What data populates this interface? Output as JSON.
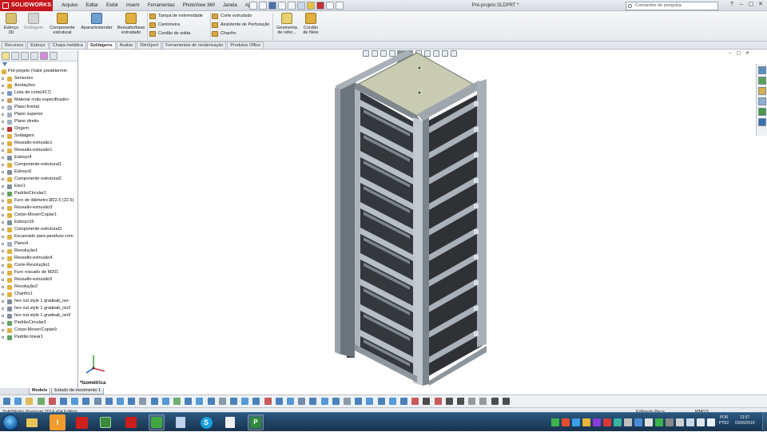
{
  "app": {
    "logo_text": "SOLIDWORKS",
    "menus": [
      "Arquivo",
      "Editar",
      "Exibir",
      "Inserir",
      "Ferramentas",
      "PhotoView 360",
      "Janela",
      "Ajuda"
    ],
    "document_title": "Pré-projeto.SLDPRT *",
    "search_placeholder": "Comandos de pesquisa",
    "window_controls": [
      "?",
      "–",
      "▢",
      "✕"
    ]
  },
  "command_manager": {
    "big_buttons": [
      {
        "label_line1": "Esboço",
        "label_line2": "3D",
        "icon": "3d-sketch-icon"
      },
      {
        "label_line1": "Soldagem",
        "label_line2": "",
        "icon": "weldment-icon"
      },
      {
        "label_line1": "Componente",
        "label_line2": "estrutural",
        "icon": "structural-member-icon"
      },
      {
        "label_line1": "Aparar/estender",
        "label_line2": "",
        "icon": "trim-extend-icon"
      },
      {
        "label_line1": "Ressalto/base",
        "label_line2": "extrudado",
        "icon": "extruded-boss-icon"
      }
    ],
    "small_buttons_col1": [
      "Tampa de extremidade",
      "Cantoneira",
      "Cordão de solda"
    ],
    "small_buttons_col2": [
      "Corte extrudado",
      "Assistente de Perfuração",
      "Chanfro"
    ],
    "big_buttons_right": [
      {
        "label_line1": "Geometria",
        "label_line2": "de refer...",
        "icon": "reference-geometry-icon"
      },
      {
        "label_line1": "Cordão",
        "label_line2": "de filete",
        "icon": "fillet-bead-icon"
      }
    ]
  },
  "tabs": [
    "Recursos",
    "Esboço",
    "Chapa metálica",
    "Soldagens",
    "Avaliar",
    "DimXpert",
    "Ferramentas de renderização",
    "Produtos Office"
  ],
  "active_tab": "Soldagens",
  "feature_tree": {
    "root": "Pré-projeto  (Valor predetermin",
    "items": [
      {
        "label": "Sensores",
        "icon": "sensor-icon",
        "color": "#e0b040"
      },
      {
        "label": "Anotações",
        "icon": "annotations-icon",
        "color": "#e0b040"
      },
      {
        "label": "Lista de corte(417)",
        "icon": "cut-list-icon",
        "color": "#7a9cc4"
      },
      {
        "label": "Material <não especificado>",
        "icon": "material-icon",
        "color": "#c8a060"
      },
      {
        "label": "Plano frontal",
        "icon": "plane-icon",
        "color": "#a0b0c0"
      },
      {
        "label": "Plano superior",
        "icon": "plane-icon",
        "color": "#a0b0c0"
      },
      {
        "label": "Plano direito",
        "icon": "plane-icon",
        "color": "#a0b0c0"
      },
      {
        "label": "Origem",
        "icon": "origin-icon",
        "color": "#c03030"
      },
      {
        "label": "Soldagem",
        "icon": "weldment-icon",
        "color": "#e0b040"
      },
      {
        "label": "Ressalto-extrusão1",
        "icon": "extrude-icon",
        "color": "#e0b040"
      },
      {
        "label": "Ressalto-extrusão1",
        "icon": "extrude-icon",
        "color": "#e0b040"
      },
      {
        "label": "Esboço4",
        "icon": "sketch-icon",
        "color": "#8090a0"
      },
      {
        "label": "Componente estrutural1",
        "icon": "structural-member-icon",
        "color": "#e0b040"
      },
      {
        "label": "Esboço6",
        "icon": "sketch-icon",
        "color": "#8090a0"
      },
      {
        "label": "Componente estrutural2",
        "icon": "structural-member-icon",
        "color": "#e0b040"
      },
      {
        "label": "Eixo1",
        "icon": "axis-icon",
        "color": "#8090a0"
      },
      {
        "label": "PadrãoCircular1",
        "icon": "circular-pattern-icon",
        "color": "#60a060"
      },
      {
        "label": "Furo de diâmetro Ø22.5 (22.5)",
        "icon": "hole-icon",
        "color": "#e0b040"
      },
      {
        "label": "Ressalto-extrusão3",
        "icon": "extrude-icon",
        "color": "#e0b040"
      },
      {
        "label": "Corpo-Mover/Copiar1",
        "icon": "move-copy-icon",
        "color": "#e0b040"
      },
      {
        "label": "Esboço16",
        "icon": "sketch-icon",
        "color": "#8090a0"
      },
      {
        "label": "Componente estrutural3",
        "icon": "structural-member-icon",
        "color": "#e0b040"
      },
      {
        "label": "Escareado para parafuso com",
        "icon": "hole-icon",
        "color": "#e0b040"
      },
      {
        "label": "Plano4",
        "icon": "plane-icon",
        "color": "#a0b0c0"
      },
      {
        "label": "Revolução1",
        "icon": "revolve-icon",
        "color": "#e0b040"
      },
      {
        "label": "Ressalto-extrusão4",
        "icon": "extrude-icon",
        "color": "#e0b040"
      },
      {
        "label": "Corte-Revolução1",
        "icon": "cut-revolve-icon",
        "color": "#e0b040"
      },
      {
        "label": "Furo roscado de M201",
        "icon": "hole-icon",
        "color": "#e0b040"
      },
      {
        "label": "Ressalto-extrusão5",
        "icon": "extrude-icon",
        "color": "#e0b040"
      },
      {
        "label": "Revolução2",
        "icon": "revolve-icon",
        "color": "#e0b040"
      },
      {
        "label": "Chanfro1",
        "icon": "chamfer-icon",
        "color": "#e0b040"
      },
      {
        "label": "hex nut style 1 gradeab_iso-",
        "icon": "library-feature-icon",
        "color": "#8090a0"
      },
      {
        "label": "hex nut style 1 gradeab_iso2",
        "icon": "library-feature-icon",
        "color": "#8090a0"
      },
      {
        "label": "hex nut style 1 gradeab_iso3",
        "icon": "library-feature-icon",
        "color": "#8090a0"
      },
      {
        "label": "PadrãoCircular3",
        "icon": "circular-pattern-icon",
        "color": "#60a060"
      },
      {
        "label": "Corpo-Mover/Copiar9",
        "icon": "move-copy-icon",
        "color": "#e0b040"
      },
      {
        "label": "Padrão linear1",
        "icon": "linear-pattern-icon",
        "color": "#60a060"
      }
    ]
  },
  "panel_bottom_tabs": [
    "Modelo",
    "Estudo de movimento 1"
  ],
  "graphics": {
    "view_label": "*Isométrica",
    "viewport_controls": [
      "–",
      "▢",
      "✕"
    ],
    "frame_colors": {
      "steel_dark": "#5a626a",
      "steel_mid": "#8b939b",
      "steel_light": "#c2c8ce",
      "top_plate": "#c9cbb3",
      "panel_dark": "#2f3135"
    }
  },
  "status": {
    "edition": "SolidWorks Premium 2014 x64 Edition",
    "editing": "Editando Peça",
    "units": "MMGS"
  },
  "taskbar": {
    "language_line1": "POR",
    "language_line2": "PTB2",
    "time": "13:57",
    "date": "15/06/2015"
  }
}
